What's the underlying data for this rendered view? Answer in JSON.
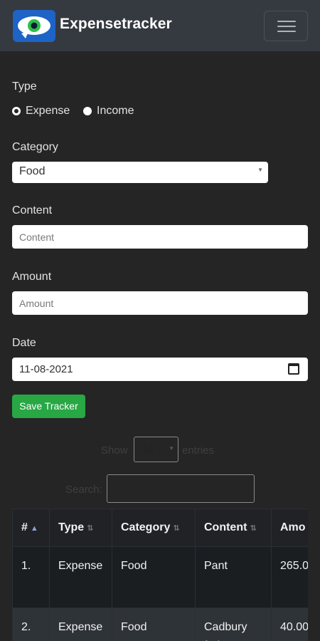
{
  "navbar": {
    "brand": "Expensetracker",
    "logo_icon": "eye-logo-icon",
    "menu_icon": "hamburger-menu-icon"
  },
  "form": {
    "type_label": "Type",
    "type_options": [
      "Expense",
      "Income"
    ],
    "type_selected": "Expense",
    "category_label": "Category",
    "category_value": "Food",
    "content_label": "Content",
    "content_placeholder": "Content",
    "amount_label": "Amount",
    "amount_placeholder": "Amount",
    "date_label": "Date",
    "date_value": "11-08-2021",
    "save_label": "Save Tracker"
  },
  "datatable": {
    "show_label": "Show",
    "entries_value": "10",
    "entries_label": "entries",
    "search_label": "Search:",
    "columns": [
      "#",
      "Type",
      "Category",
      "Content",
      "Amo"
    ],
    "rows": [
      {
        "num": "1.",
        "type": "Expense",
        "category": "Food",
        "content": "Pant",
        "amount": "265.0"
      },
      {
        "num": "2.",
        "type": "Expense",
        "category": "Food",
        "content": "Cadbury fruit & nut",
        "amount": "40.00"
      }
    ]
  },
  "colors": {
    "navbar": "#343a40",
    "page_background": "#252526",
    "save_button": "#28a745",
    "logo": "#1e63c6"
  }
}
